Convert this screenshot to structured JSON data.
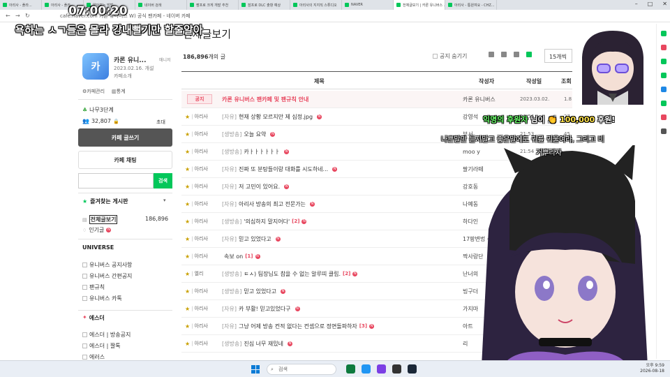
{
  "stream": {
    "clock": "07:00:20",
    "caption": "욕하는 ㅅㄱ들은 몰라 강내뻘기만 할줄알아",
    "donation": {
      "name": "익명의 후원자",
      "mid": "님이",
      "amount": "100,000",
      "suffix": "후원!"
    },
    "donation_message_line1": "나쁜말만 듣지말고 좋은말에도 귀를 귀울여라, 그리고 비",
    "donation_message_line2": "거뿌리자"
  },
  "browser": {
    "tabs": [
      {
        "label": "아리사 - 플라...",
        "active": false
      },
      {
        "label": "아리사 - 플라...",
        "active": false
      },
      {
        "label": "알아보는 방법 ...",
        "active": false
      },
      {
        "label": "네이버 검색",
        "active": false
      },
      {
        "label": "짬프로 크게 개발 추천",
        "active": false
      },
      {
        "label": "잠프로 DLC 출항 예상",
        "active": false
      },
      {
        "label": "아리사의 지지직 스튜디오",
        "active": false
      },
      {
        "label": "NAVER",
        "active": false
      },
      {
        "label": "전체글보기 | 카론 유니버스 ...",
        "active": true
      },
      {
        "label": "아리사 - 통윈여요 - CHZ...",
        "active": false
      }
    ],
    "url": "cafe.naver.com   카론 유니버스 W) 공식 팬카페 - 네이버 카페"
  },
  "sidebar": {
    "logo_text": "카",
    "cafe_name": "카론 유니...",
    "manager_label": "매니저",
    "opened": "2023.02.16. 개설",
    "intro_link": "카페소개",
    "manage_link": "카페관리",
    "stats_link": "통계",
    "level": "나무3단계",
    "members": "32,807",
    "invite": "초대",
    "write_button": "카페 글쓰기",
    "chat_button": "카페 채팅",
    "search_placeholder": "",
    "search_button": "검색",
    "favorites_title": "즐겨찾는 게시판",
    "all_posts": "전체글보기",
    "all_posts_count": "186,896",
    "popular": "인기글",
    "section_universe": "UNIVERSE",
    "universe_items": [
      "유니버스 공지사항",
      "유니버스 간편공지",
      "팬규칙",
      "유니버스 카톡"
    ],
    "section_esther": "에스더",
    "esther_items": [
      "에스더 | 방송공지",
      "에스더 | 짤톡",
      "에러스"
    ]
  },
  "board": {
    "title": "전체글보기",
    "post_count_num": "186,896",
    "post_count_suffix": "개의 글",
    "notice_toggle": "공지 숨기기",
    "per_page": "15개씩",
    "columns": {
      "subject": "제목",
      "author": "작성자",
      "date": "작성일",
      "views": "조회"
    },
    "notice": {
      "tag": "공지",
      "subject": "카론 유니버스 팬카페 및 팬규칙 안내",
      "author": "카론 유니버스",
      "date": "2023.03.02.",
      "views": "1.8"
    },
    "rows": [
      {
        "board": "아리사",
        "head": "[자유]",
        "subject": "현재 상황 모르지만 제 심정.jpg",
        "comments": "",
        "author": "강영석",
        "date": "21:56",
        "views": "27"
      },
      {
        "board": "아리사",
        "head": "[생방송]",
        "subject": "오늘 요약",
        "comments": "",
        "author": "부서",
        "date": "21:53",
        "views": "45"
      },
      {
        "board": "아리사",
        "head": "[생방송]",
        "subject": "카ㅏㅏㅏㅏㅏㅏ",
        "comments": "",
        "author": "moo y",
        "date": "21:54",
        "views": ""
      },
      {
        "board": "아리사",
        "head": "[자유]",
        "subject": "진짜 또 분탕들이랑 대화를 시도하네...",
        "comments": "",
        "author": "팔기라떼",
        "date": "",
        "views": "90"
      },
      {
        "board": "아리사",
        "head": "[자유]",
        "subject": "저 고민이 있어요.",
        "comments": "",
        "author": "강호동",
        "date": "",
        "views": ""
      },
      {
        "board": "아리사",
        "head": "[자유]",
        "subject": "아리사 방송의 최고 전문가는",
        "comments": "",
        "author": "나예동",
        "date": "",
        "views": ""
      },
      {
        "board": "아리사",
        "head": "[생방송]",
        "subject": "'의심하지 말지어다'",
        "comments": "[2]",
        "author": "하다인",
        "date": "",
        "views": ""
      },
      {
        "board": "아리사",
        "head": "[자유]",
        "subject": "믿고 있었다고",
        "comments": "",
        "author": "17팡변법 식사",
        "date": "",
        "views": ""
      },
      {
        "board": "아리사",
        "head": "",
        "subject": "속보 on",
        "comments": "[1]",
        "author": "짝사랑단",
        "date": "",
        "views": ""
      },
      {
        "board": "엘리",
        "head": "[생방송]",
        "subject": "ㅌㅅ) 팀장님도 참을 수 없는 알루띠 클립.",
        "comments": "[2]",
        "author": "난너의",
        "date": "",
        "views": ""
      },
      {
        "board": "아리사",
        "head": "[생방송]",
        "subject": "믿고 있었다고",
        "comments": "",
        "author": "빙구더",
        "date": "",
        "views": ""
      },
      {
        "board": "아리사",
        "head": "[자유]",
        "subject": "카 부활! 믿고있었다구",
        "comments": "",
        "author": "가지마",
        "date": "",
        "views": ""
      },
      {
        "board": "아리사",
        "head": "[자유]",
        "subject": "그냥 어제 방송 컨적 없다는 컨셉으로 정면돌파하자",
        "comments": "[3]",
        "author": "아트",
        "date": "",
        "views": ""
      },
      {
        "board": "아리사",
        "head": "[생방송]",
        "subject": "진심 너무 재밌네",
        "comments": "",
        "author": "리",
        "date": "",
        "views": ""
      }
    ]
  },
  "taskbar": {
    "search_placeholder": "검색",
    "time": "오후 9:59",
    "date": "2026-08-18"
  },
  "colors": {
    "accent": "#03c75a",
    "notice_red": "#e8475f"
  }
}
